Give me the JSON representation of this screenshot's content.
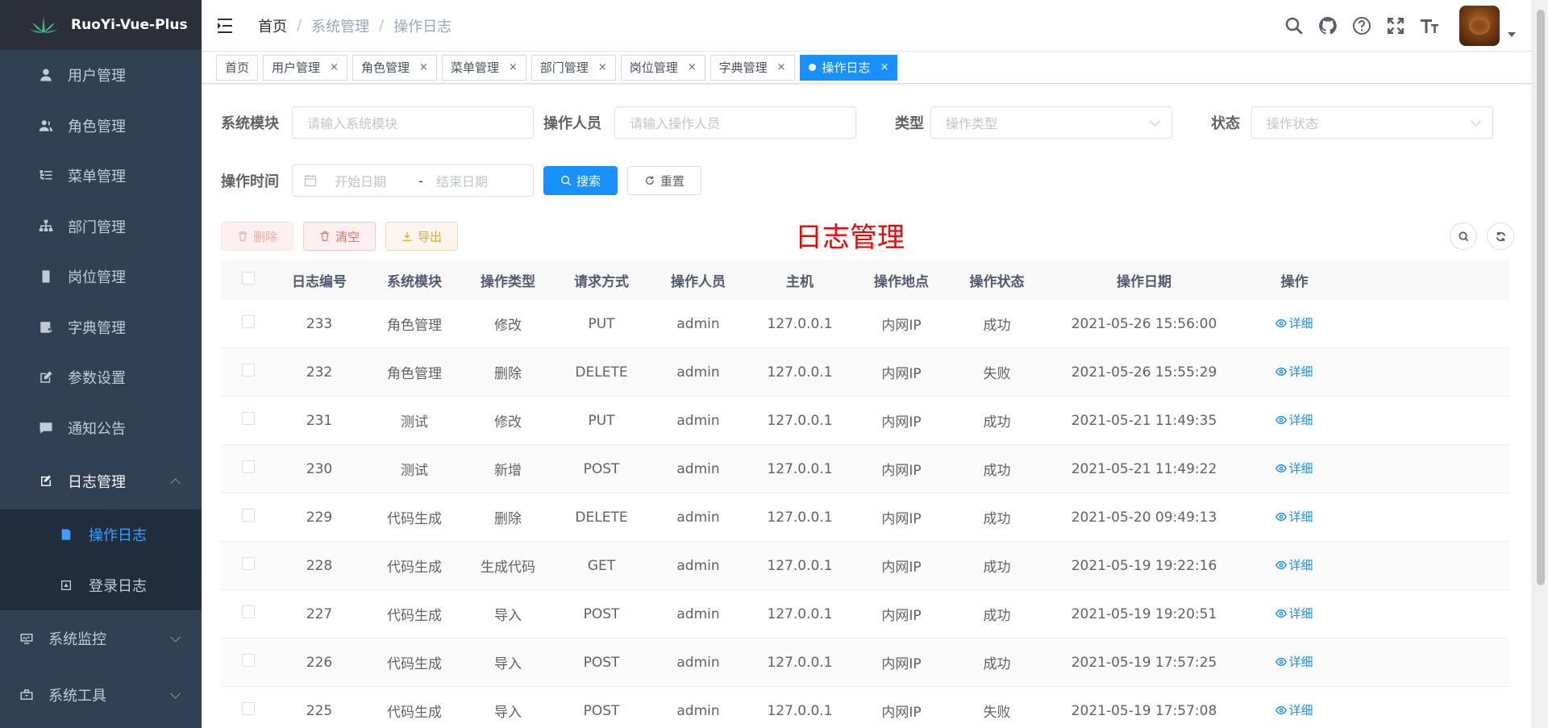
{
  "app": {
    "name": "RuoYi-Vue-Plus"
  },
  "sidebar": {
    "items": [
      {
        "label": "用户管理",
        "icon": "user-icon"
      },
      {
        "label": "角色管理",
        "icon": "peoples-icon"
      },
      {
        "label": "菜单管理",
        "icon": "tree-table-icon"
      },
      {
        "label": "部门管理",
        "icon": "tree-icon"
      },
      {
        "label": "岗位管理",
        "icon": "post-icon"
      },
      {
        "label": "字典管理",
        "icon": "dict-icon"
      },
      {
        "label": "参数设置",
        "icon": "edit-icon"
      },
      {
        "label": "通知公告",
        "icon": "message-icon"
      }
    ],
    "log_group": {
      "label": "日志管理",
      "children": [
        {
          "label": "操作日志",
          "active": true
        },
        {
          "label": "登录日志",
          "active": false
        }
      ]
    },
    "monitor": {
      "label": "系统监控"
    },
    "tools": {
      "label": "系统工具"
    }
  },
  "navbar": {
    "breadcrumb": [
      "首页",
      "系统管理",
      "操作日志"
    ]
  },
  "tags": [
    {
      "label": "首页",
      "closable": false,
      "active": false
    },
    {
      "label": "用户管理",
      "closable": true,
      "active": false
    },
    {
      "label": "角色管理",
      "closable": true,
      "active": false
    },
    {
      "label": "菜单管理",
      "closable": true,
      "active": false
    },
    {
      "label": "部门管理",
      "closable": true,
      "active": false
    },
    {
      "label": "岗位管理",
      "closable": true,
      "active": false
    },
    {
      "label": "字典管理",
      "closable": true,
      "active": false
    },
    {
      "label": "操作日志",
      "closable": true,
      "active": true
    }
  ],
  "close_glyph": "×",
  "search": {
    "module_label": "系统模块",
    "module_placeholder": "请输入系统模块",
    "operator_label": "操作人员",
    "operator_placeholder": "请输入操作人员",
    "type_label": "类型",
    "type_placeholder": "操作类型",
    "status_label": "状态",
    "status_placeholder": "操作状态",
    "time_label": "操作时间",
    "start_placeholder": "开始日期",
    "range_sep": "-",
    "end_placeholder": "结束日期",
    "search_btn": "搜索",
    "reset_btn": "重置"
  },
  "toolbar": {
    "delete_btn": "删除",
    "clear_btn": "清空",
    "export_btn": "导出"
  },
  "page_heading": "日志管理",
  "table": {
    "columns": [
      "日志编号",
      "系统模块",
      "操作类型",
      "请求方式",
      "操作人员",
      "主机",
      "操作地点",
      "操作状态",
      "操作日期",
      "操作"
    ],
    "detail_label": "详细",
    "rows": [
      {
        "id": "233",
        "module": "角色管理",
        "type": "修改",
        "method": "PUT",
        "operator": "admin",
        "host": "127.0.0.1",
        "location": "内网IP",
        "status": "成功",
        "date": "2021-05-26 15:56:00"
      },
      {
        "id": "232",
        "module": "角色管理",
        "type": "删除",
        "method": "DELETE",
        "operator": "admin",
        "host": "127.0.0.1",
        "location": "内网IP",
        "status": "失败",
        "date": "2021-05-26 15:55:29"
      },
      {
        "id": "231",
        "module": "测试",
        "type": "修改",
        "method": "PUT",
        "operator": "admin",
        "host": "127.0.0.1",
        "location": "内网IP",
        "status": "成功",
        "date": "2021-05-21 11:49:35"
      },
      {
        "id": "230",
        "module": "测试",
        "type": "新增",
        "method": "POST",
        "operator": "admin",
        "host": "127.0.0.1",
        "location": "内网IP",
        "status": "成功",
        "date": "2021-05-21 11:49:22"
      },
      {
        "id": "229",
        "module": "代码生成",
        "type": "删除",
        "method": "DELETE",
        "operator": "admin",
        "host": "127.0.0.1",
        "location": "内网IP",
        "status": "成功",
        "date": "2021-05-20 09:49:13"
      },
      {
        "id": "228",
        "module": "代码生成",
        "type": "生成代码",
        "method": "GET",
        "operator": "admin",
        "host": "127.0.0.1",
        "location": "内网IP",
        "status": "成功",
        "date": "2021-05-19 19:22:16"
      },
      {
        "id": "227",
        "module": "代码生成",
        "type": "导入",
        "method": "POST",
        "operator": "admin",
        "host": "127.0.0.1",
        "location": "内网IP",
        "status": "成功",
        "date": "2021-05-19 19:20:51"
      },
      {
        "id": "226",
        "module": "代码生成",
        "type": "导入",
        "method": "POST",
        "operator": "admin",
        "host": "127.0.0.1",
        "location": "内网IP",
        "status": "成功",
        "date": "2021-05-19 17:57:25"
      },
      {
        "id": "225",
        "module": "代码生成",
        "type": "导入",
        "method": "POST",
        "operator": "admin",
        "host": "127.0.0.1",
        "location": "内网IP",
        "status": "失败",
        "date": "2021-05-19 17:57:08"
      }
    ]
  },
  "colors": {
    "sidebar_bg": "#304156",
    "primary": "#1890ff",
    "danger": "#f56c6c",
    "warning": "#e6a23c",
    "heading_red": "#ff0000"
  }
}
